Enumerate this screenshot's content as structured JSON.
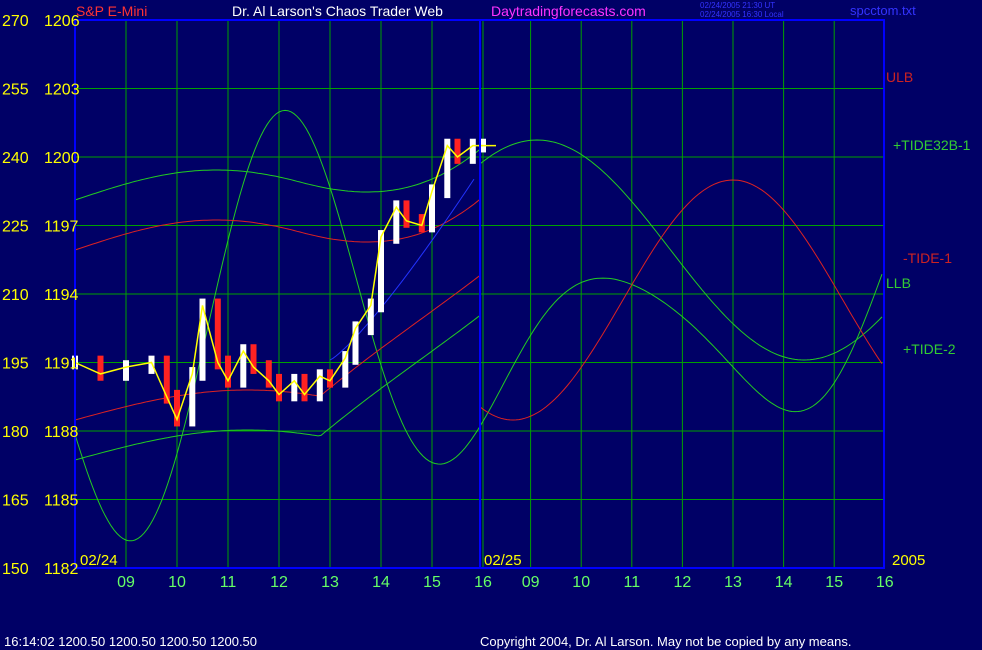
{
  "header": {
    "instrument": "S&P E-Mini",
    "site_title": "Dr. Al Larson's Chaos Trader Web",
    "site_url": "Daytradingforecasts.com",
    "timestamp_ut": "02/24/2005 21:30 UT",
    "timestamp_local": "02/24/2005 16:30 Local",
    "file_name": "spcctom.txt"
  },
  "footer": {
    "quote": "16:14:02  1200.50 1200.50 1200.50 1200.50",
    "copyright": "Copyright 2004, Dr. Al Larson. May not be copied by any means."
  },
  "colors": {
    "background": "#000066",
    "grid": "#00a000",
    "axis": "#0000ff",
    "green_label": "#33cc33",
    "red_label": "#cc2222",
    "price_labels": "#ffff00",
    "x_ticks": "#66ff66",
    "site_url": "#ff33ff",
    "file_name": "#3333ff"
  },
  "chart_data": {
    "type": "line",
    "y_left_labels": [
      "270",
      "255",
      "240",
      "225",
      "210",
      "195",
      "180",
      "165",
      "150"
    ],
    "y_price_labels": [
      "1206",
      "1203",
      "1200",
      "1197",
      "1194",
      "1191",
      "1188",
      "1185",
      "1182"
    ],
    "x_tick_labels": [
      "09",
      "10",
      "11",
      "12",
      "13",
      "14",
      "15",
      "16",
      "09",
      "10",
      "11",
      "12",
      "13",
      "14",
      "15",
      "16"
    ],
    "date_labels": [
      "02/24",
      "02/25"
    ],
    "year_label": "2005",
    "series_labels": [
      {
        "text": "ULB",
        "color": "#cc2222"
      },
      {
        "text": "+TIDE32B-1",
        "color": "#33cc33"
      },
      {
        "text": "-TIDE-1",
        "color": "#cc2222"
      },
      {
        "text": "LLB",
        "color": "#33cc33"
      },
      {
        "text": "+TIDE-2",
        "color": "#33cc33"
      }
    ],
    "price": {
      "hours": [
        8.0,
        8.5,
        9.0,
        9.5,
        9.8,
        10.0,
        10.3,
        10.5,
        10.8,
        11.0,
        11.3,
        11.5,
        11.8,
        12.0,
        12.3,
        12.5,
        12.8,
        13.0,
        13.3,
        13.5,
        13.8,
        14.0,
        14.3,
        14.5,
        14.8,
        15.0,
        15.3,
        15.5,
        15.8,
        16.0
      ],
      "values": [
        1191,
        1190.5,
        1190.8,
        1191.0,
        1189.5,
        1188.5,
        1190.5,
        1193.5,
        1191,
        1190.2,
        1191.5,
        1190.8,
        1190.2,
        1189.6,
        1190.2,
        1189.6,
        1190.4,
        1190.2,
        1191.2,
        1192.5,
        1193.5,
        1196.5,
        1197.8,
        1197.2,
        1197,
        1198.5,
        1200.5,
        1200,
        1200.5,
        1200.5
      ]
    },
    "ylim": [
      150,
      270
    ],
    "price_lim": [
      1182,
      1206
    ],
    "grid": true
  }
}
